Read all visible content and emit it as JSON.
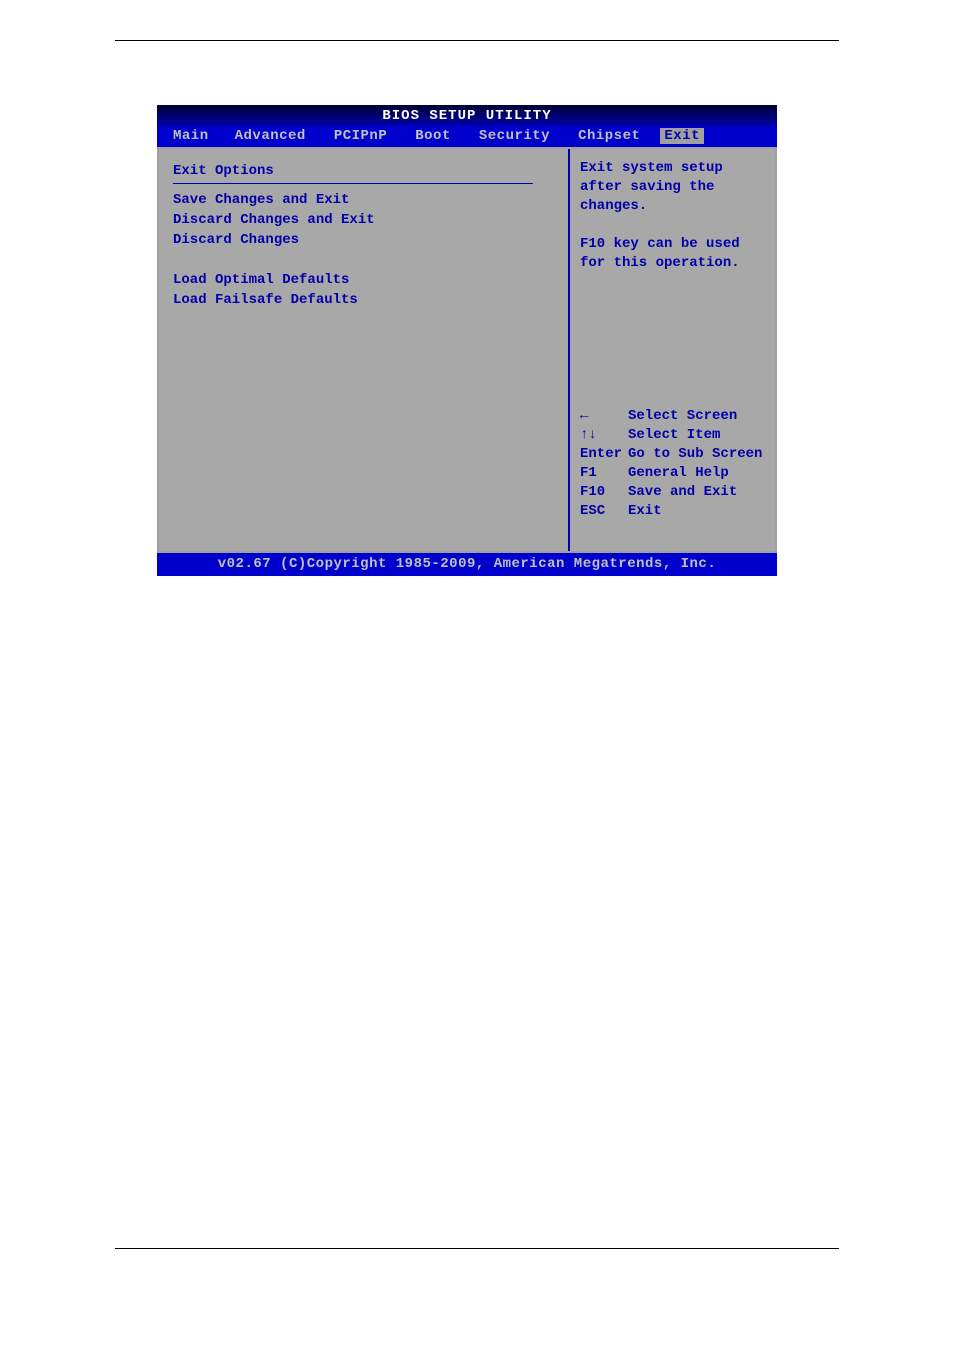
{
  "title": "BIOS SETUP UTILITY",
  "tabs": [
    "Main",
    "Advanced",
    "PCIPnP",
    "Boot",
    "Security",
    "Chipset",
    "Exit"
  ],
  "selected_tab": "Exit",
  "left": {
    "section_title": "Exit Options",
    "items": [
      "Save Changes and Exit",
      "Discard Changes and Exit",
      "Discard Changes",
      "",
      "Load Optimal Defaults",
      "Load Failsafe Defaults"
    ]
  },
  "help": {
    "line1": "Exit system setup",
    "line2": "after saving the",
    "line3": "changes.",
    "line4": "F10 key can be used",
    "line5": "for this operation."
  },
  "nav": [
    {
      "key": "←",
      "label": "Select Screen"
    },
    {
      "key": "↑↓",
      "label": "Select Item"
    },
    {
      "key": "Enter",
      "label": "Go to Sub Screen"
    },
    {
      "key": "F1",
      "label": "General Help"
    },
    {
      "key": "F10",
      "label": "Save and Exit"
    },
    {
      "key": "ESC",
      "label": "Exit"
    }
  ],
  "footer": "v02.67 (C)Copyright 1985-2009, American Megatrends, Inc."
}
